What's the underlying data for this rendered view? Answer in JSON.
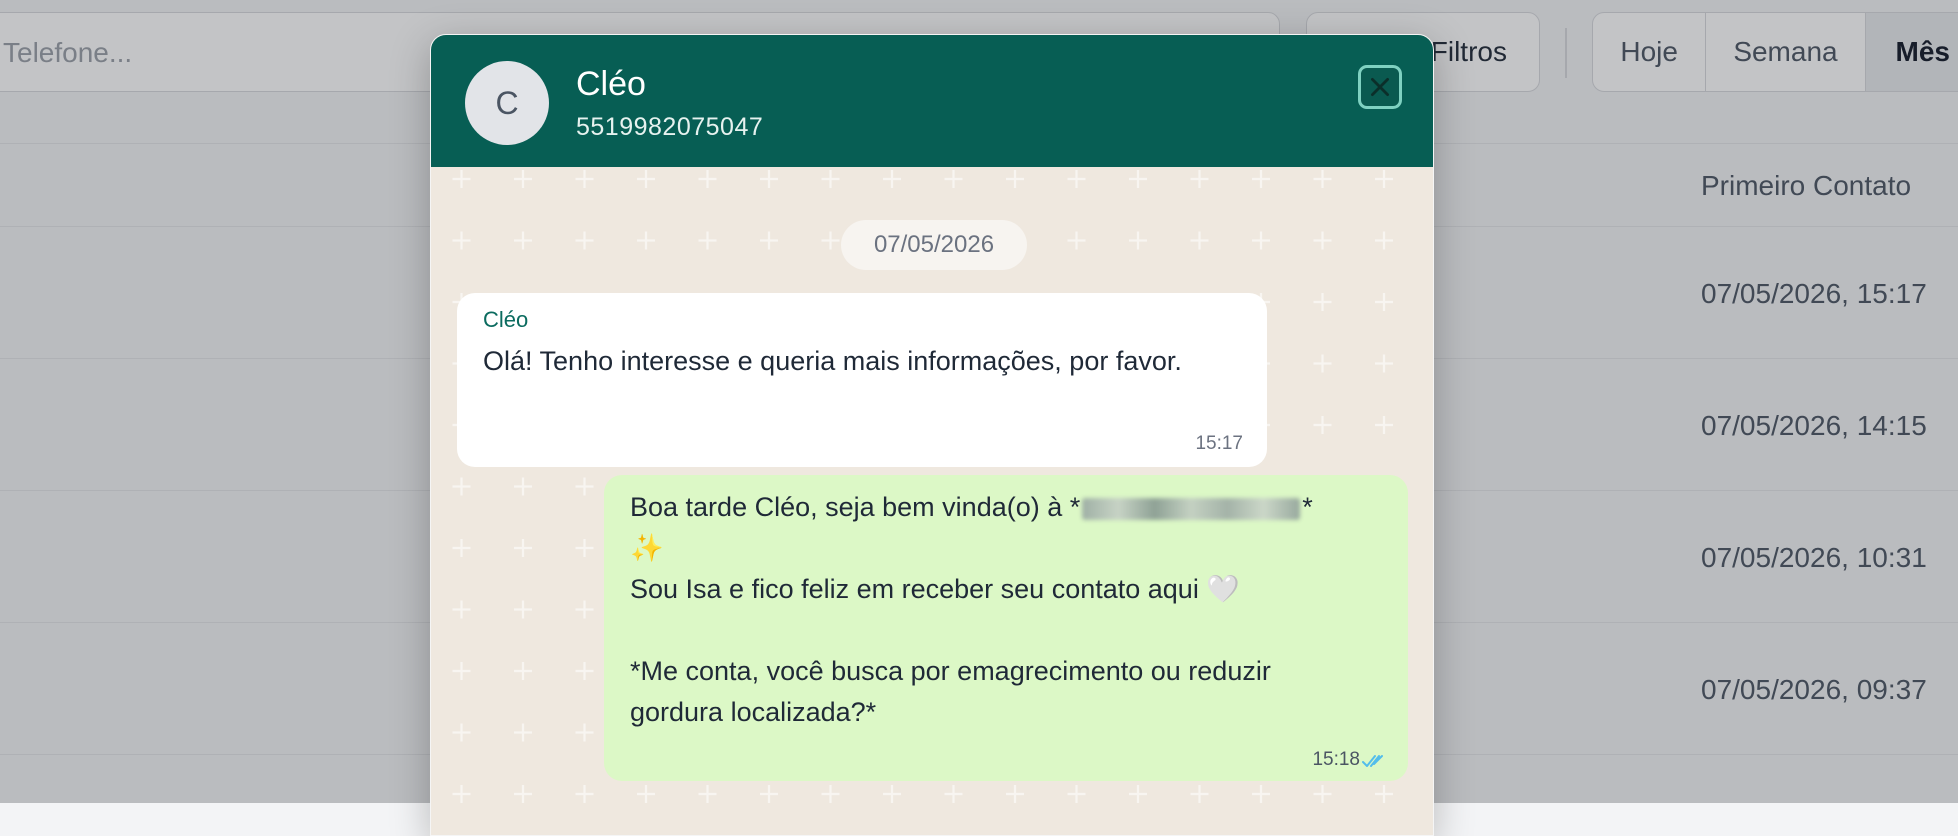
{
  "toolbar": {
    "search_placeholder": "Telefone...",
    "filters_label": "Filtros",
    "period_options": [
      "Hoje",
      "Semana",
      "Mês"
    ],
    "selected_period": "Mês"
  },
  "table": {
    "header": "Primeiro Contato",
    "first_contact_values": [
      "07/05/2026, 15:17",
      "07/05/2026, 14:15",
      "07/05/2026, 10:31",
      "07/05/2026, 09:37"
    ]
  },
  "chat_modal": {
    "contact": {
      "avatar_initial": "C",
      "name": "Cléo",
      "phone": "5519982075047"
    },
    "close_icon": "close-icon",
    "date_separator": "07/05/2026",
    "messages": [
      {
        "direction": "incoming",
        "sender": "Cléo",
        "text": "Olá! Tenho interesse e queria mais informações, por favor.",
        "time": "15:17"
      },
      {
        "direction": "outgoing",
        "lines": {
          "l1_before": "Boa tarde Cléo, seja bem vinda(o) à *",
          "l1_after": "*",
          "l2": "✨",
          "l3": "Sou Isa e fico feliz em receber seu contato aqui",
          "l3_emoji": "🤍",
          "l5": "*Me conta, você busca por emagrecimento ou reduzir",
          "l6": "gordura localizada?*"
        },
        "time": "15:18",
        "status_icon": "double-check-icon",
        "status_color": "#53bdeb"
      }
    ]
  },
  "colors": {
    "header_green": "#075e54",
    "outgoing_bubble": "#dcf8c6",
    "incoming_bubble": "#ffffff",
    "chat_background": "#efe8df"
  }
}
